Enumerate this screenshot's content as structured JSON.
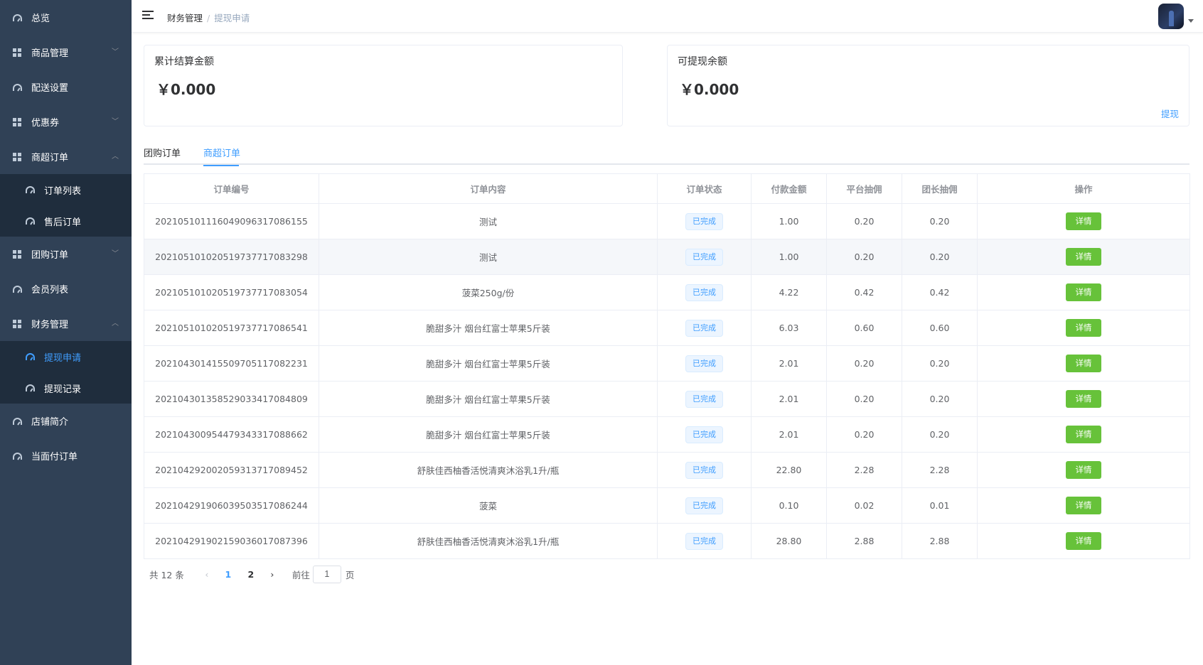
{
  "sidebar": {
    "items": [
      {
        "label": "总览"
      },
      {
        "label": "商品管理"
      },
      {
        "label": "配送设置"
      },
      {
        "label": "优惠券"
      },
      {
        "label": "商超订单"
      },
      {
        "label": "订单列表"
      },
      {
        "label": "售后订单"
      },
      {
        "label": "团购订单"
      },
      {
        "label": "会员列表"
      },
      {
        "label": "财务管理"
      },
      {
        "label": "提现申请"
      },
      {
        "label": "提现记录"
      },
      {
        "label": "店铺简介"
      },
      {
        "label": "当面付订单"
      }
    ]
  },
  "header": {
    "breadcrumb": [
      "财务管理",
      "/",
      "提现申请"
    ]
  },
  "cards": {
    "total_label": "累计结算金额",
    "total_value": "￥0.000",
    "available_label": "可提现余额",
    "available_value": "￥0.000",
    "withdraw_link": "提现"
  },
  "tabs": [
    "团购订单",
    "商超订单"
  ],
  "table": {
    "headers": [
      "订单编号",
      "订单内容",
      "订单状态",
      "付款金额",
      "平台抽佣",
      "团长抽佣",
      "操作"
    ],
    "rows": [
      {
        "id": "202105101116049096317086155",
        "content": "测试",
        "status": "已完成",
        "amount": "1.00",
        "platform": "0.20",
        "leader": "0.20",
        "action": "详情"
      },
      {
        "id": "202105101020519737717083298",
        "content": "测试",
        "status": "已完成",
        "amount": "1.00",
        "platform": "0.20",
        "leader": "0.20",
        "action": "详情"
      },
      {
        "id": "202105101020519737717083054",
        "content": "菠菜250g/份",
        "status": "已完成",
        "amount": "4.22",
        "platform": "0.42",
        "leader": "0.42",
        "action": "详情"
      },
      {
        "id": "202105101020519737717086541",
        "content": "脆甜多汁 烟台红富士苹果5斤装",
        "status": "已完成",
        "amount": "6.03",
        "platform": "0.60",
        "leader": "0.60",
        "action": "详情"
      },
      {
        "id": "202104301415509705117082231",
        "content": "脆甜多汁 烟台红富士苹果5斤装",
        "status": "已完成",
        "amount": "2.01",
        "platform": "0.20",
        "leader": "0.20",
        "action": "详情"
      },
      {
        "id": "202104301358529033417084809",
        "content": "脆甜多汁 烟台红富士苹果5斤装",
        "status": "已完成",
        "amount": "2.01",
        "platform": "0.20",
        "leader": "0.20",
        "action": "详情"
      },
      {
        "id": "202104300954479343317088662",
        "content": "脆甜多汁 烟台红富士苹果5斤装",
        "status": "已完成",
        "amount": "2.01",
        "platform": "0.20",
        "leader": "0.20",
        "action": "详情"
      },
      {
        "id": "202104292002059313717089452",
        "content": "舒肤佳西柚香活悦清爽沐浴乳1升/瓶",
        "status": "已完成",
        "amount": "22.80",
        "platform": "2.28",
        "leader": "2.28",
        "action": "详情"
      },
      {
        "id": "202104291906039503517086244",
        "content": "菠菜",
        "status": "已完成",
        "amount": "0.10",
        "platform": "0.02",
        "leader": "0.01",
        "action": "详情"
      },
      {
        "id": "202104291902159036017087396",
        "content": "舒肤佳西柚香活悦清爽沐浴乳1升/瓶",
        "status": "已完成",
        "amount": "28.80",
        "platform": "2.88",
        "leader": "2.88",
        "action": "详情"
      }
    ]
  },
  "pagination": {
    "total": "共 12 条",
    "pages": [
      "1",
      "2"
    ],
    "goto_label": "前往",
    "goto_value": "1",
    "page_suffix": "页"
  }
}
